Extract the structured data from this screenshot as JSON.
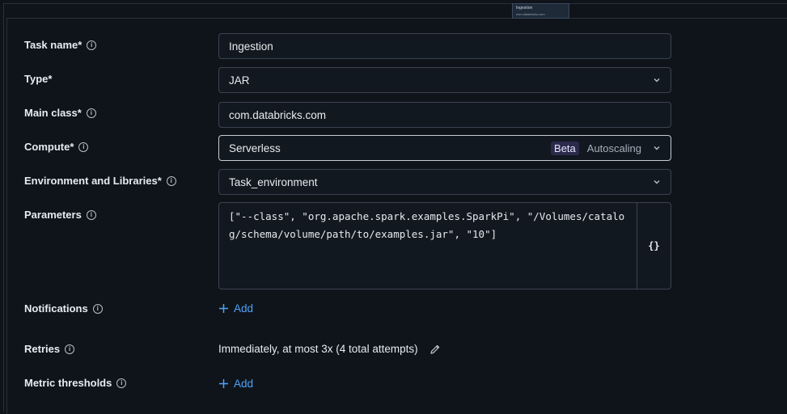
{
  "preview": {
    "title": "Ingestion",
    "subtitle": "com.databricks.com"
  },
  "form": {
    "task_name": {
      "label": "Task name*",
      "value": "Ingestion"
    },
    "type": {
      "label": "Type*",
      "value": "JAR"
    },
    "main_class": {
      "label": "Main class*",
      "value": "com.databricks.com"
    },
    "compute": {
      "label": "Compute*",
      "value": "Serverless",
      "badge": "Beta",
      "secondary": "Autoscaling"
    },
    "environment": {
      "label": "Environment and Libraries*",
      "value": "Task_environment"
    },
    "parameters": {
      "label": "Parameters",
      "value": "[\"--class\", \"org.apache.spark.examples.SparkPi\", \"/Volumes/catalog/schema/volume/path/to/examples.jar\", \"10\"]",
      "json_toggle": "{}"
    },
    "notifications": {
      "label": "Notifications",
      "add_label": "Add"
    },
    "retries": {
      "label": "Retries",
      "value": "Immediately, at most 3x (4 total attempts)"
    },
    "metric_thresholds": {
      "label": "Metric thresholds",
      "add_label": "Add"
    }
  },
  "icons": {
    "info": "info-circle-icon",
    "chevron": "chevron-down-icon",
    "plus": "plus-icon",
    "pencil": "pencil-icon"
  },
  "colors": {
    "background": "#0f141b",
    "link": "#4fa3f7",
    "border": "#3b4350",
    "beta_bg": "#2b2a4a"
  }
}
